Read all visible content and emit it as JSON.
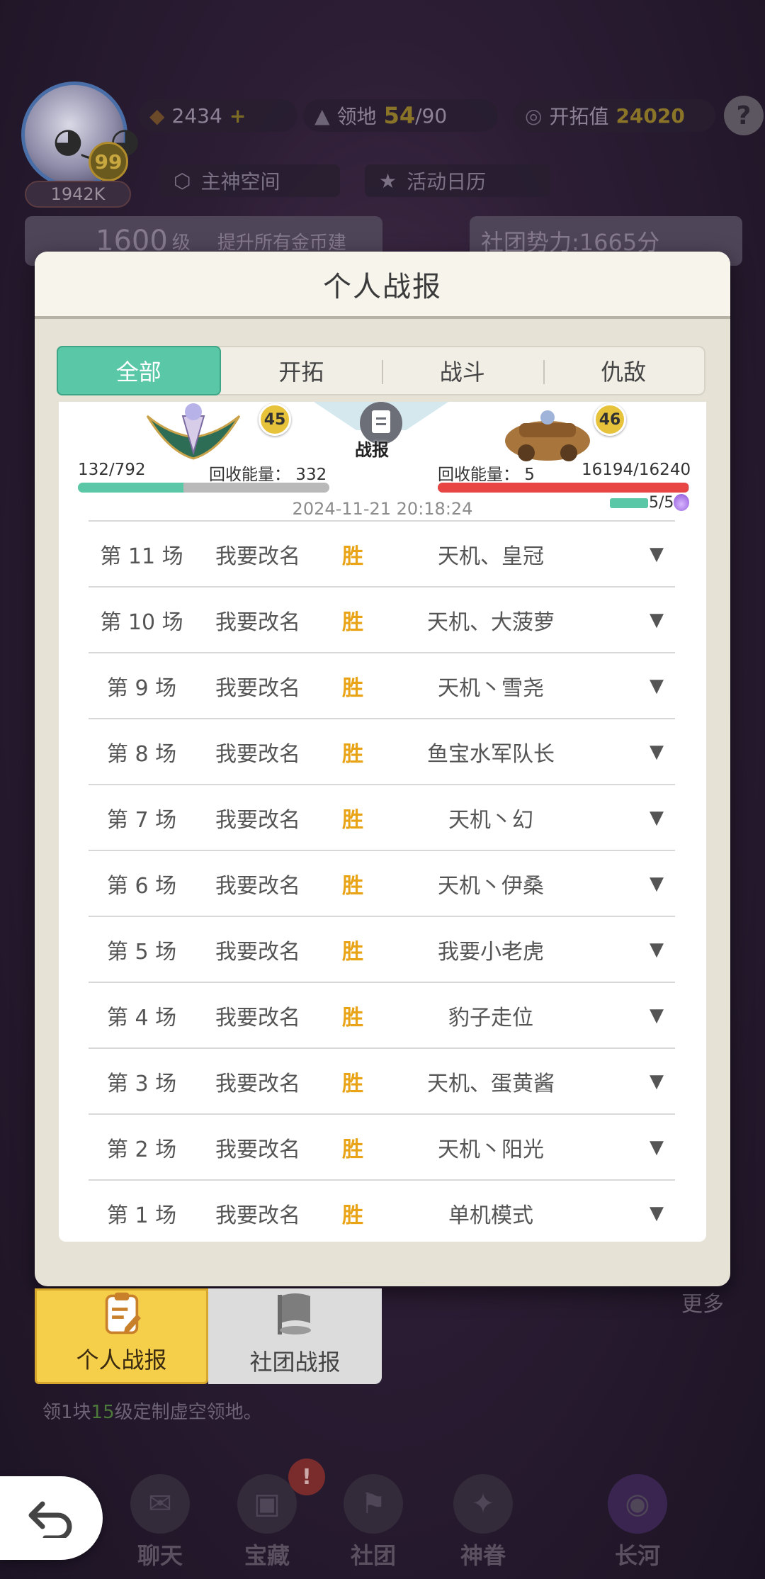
{
  "hud": {
    "player_level": "99",
    "power": "1942K",
    "currency": "2434",
    "territory_label": "领地",
    "territory_value": "54",
    "territory_max": "/90",
    "explore_label": "开拓值",
    "explore_value": "24020",
    "help": "?",
    "god_space": "主神空间",
    "calendar": "活动日历",
    "rank_level": "1600",
    "rank_unit": "级",
    "rank_desc": "提升所有金币建",
    "club_power": "社团势力:1665分"
  },
  "modal": {
    "title": "个人战报",
    "tabs": [
      "全部",
      "开拓",
      "战斗",
      "仇敌"
    ],
    "summary": {
      "left_level": "45",
      "right_level": "46",
      "report_label": "战报",
      "left_hp": "132/792",
      "left_energy": "回收能量： 332",
      "right_energy": "回收能量： 5",
      "right_hp": "16194/16240",
      "date": "2024-11-21 20:18:24",
      "energy_count": "5/5",
      "left_hp_fraction": 0.42,
      "right_hp_fraction": 0.997
    },
    "rows": [
      {
        "round": "第 11 场",
        "me": "我要改名",
        "result": "胜",
        "opponent": "天机、皇冠"
      },
      {
        "round": "第 10 场",
        "me": "我要改名",
        "result": "胜",
        "opponent": "天机、大菠萝"
      },
      {
        "round": "第 9 场",
        "me": "我要改名",
        "result": "胜",
        "opponent": "天机丶雪尧"
      },
      {
        "round": "第 8 场",
        "me": "我要改名",
        "result": "胜",
        "opponent": "鱼宝水军队长"
      },
      {
        "round": "第 7 场",
        "me": "我要改名",
        "result": "胜",
        "opponent": "天机丶幻"
      },
      {
        "round": "第 6 场",
        "me": "我要改名",
        "result": "胜",
        "opponent": "天机丶伊桑"
      },
      {
        "round": "第 5 场",
        "me": "我要改名",
        "result": "胜",
        "opponent": "我要小老虎"
      },
      {
        "round": "第 4 场",
        "me": "我要改名",
        "result": "胜",
        "opponent": "豹子走位"
      },
      {
        "round": "第 3 场",
        "me": "我要改名",
        "result": "胜",
        "opponent": "天机、蛋黄酱"
      },
      {
        "round": "第 2 场",
        "me": "我要改名",
        "result": "胜",
        "opponent": "天机丶阳光"
      },
      {
        "round": "第 1 场",
        "me": "我要改名",
        "result": "胜",
        "opponent": "单机模式"
      }
    ]
  },
  "report_tabs": {
    "personal": "个人战报",
    "club": "社团战报"
  },
  "background": {
    "more": "更多",
    "hint_prefix": "领1块",
    "hint_level": "15",
    "hint_suffix": "级定制虚空领地。",
    "nav": [
      "聊天",
      "宝藏",
      "社团",
      "神眷",
      "长河"
    ],
    "treasure_badge": "!"
  },
  "colors": {
    "accent_green": "#5ac7a6",
    "win_orange": "#e8a317",
    "hp_red": "#e84545",
    "personal_tab_yellow": "#f6cf4a"
  }
}
